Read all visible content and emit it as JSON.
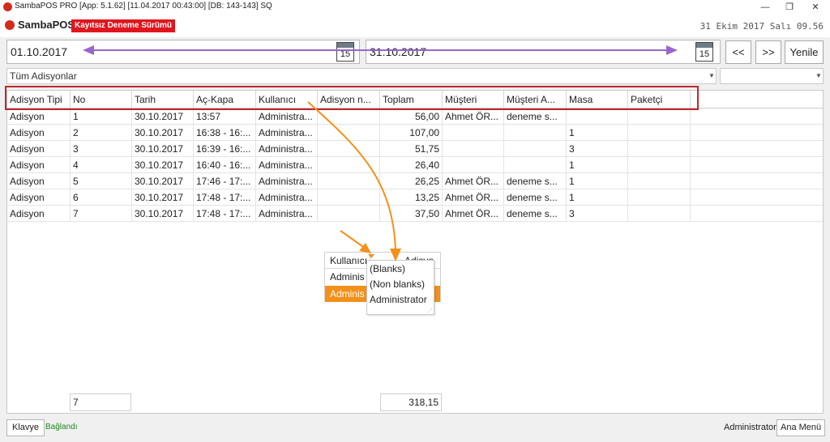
{
  "titlebar": {
    "title": "SambaPOS PRO [App: 5.1.62] [11.04.2017 00:43:00] [DB: 143-143] SQ",
    "minimize": "—",
    "restore": "❐",
    "close": "✕"
  },
  "brand": {
    "logo_text": "SambaPOS",
    "trial_badge": "Kayıtsız Deneme Sürümü",
    "clock": "31 Ekim 2017 Salı 09.56"
  },
  "filters": {
    "start_date": "01.10.2017",
    "end_date": "31.10.2017",
    "calendar_day": "15",
    "prev_label": "<<",
    "next_label": ">>",
    "refresh_label": "Yenile",
    "ticket_type": "Tüm Adisyonlar",
    "second_combo": ""
  },
  "columns": [
    "Adisyon Tipi",
    "No",
    "Tarih",
    "Aç-Kapa",
    "Kullanıcı",
    "Adisyon n...",
    "Toplam",
    "Müşteri",
    "Müşteri A...",
    "Masa",
    "Paketçi"
  ],
  "rows": [
    [
      "Adisyon",
      "1",
      "30.10.2017",
      "13:57",
      "Administra...",
      "",
      "56,00",
      "Ahmet ÖR...",
      "deneme s...",
      "",
      ""
    ],
    [
      "Adisyon",
      "2",
      "30.10.2017",
      "16:38 - 16:...",
      "Administra...",
      "",
      "107,00",
      "",
      "",
      "1",
      ""
    ],
    [
      "Adisyon",
      "3",
      "30.10.2017",
      "16:39 - 16:...",
      "Administra...",
      "",
      "51,75",
      "",
      "",
      "3",
      ""
    ],
    [
      "Adisyon",
      "4",
      "30.10.2017",
      "16:40 - 16:...",
      "Administra...",
      "",
      "26,40",
      "",
      "",
      "1",
      ""
    ],
    [
      "Adisyon",
      "5",
      "30.10.2017",
      "17:46 - 17:...",
      "Administra...",
      "",
      "26,25",
      "Ahmet ÖR...",
      "deneme s...",
      "1",
      ""
    ],
    [
      "Adisyon",
      "6",
      "30.10.2017",
      "17:48 - 17:...",
      "Administra...",
      "",
      "13,25",
      "Ahmet ÖR...",
      "deneme s...",
      "1",
      ""
    ],
    [
      "Adisyon",
      "7",
      "30.10.2017",
      "17:48 - 17:...",
      "Administra...",
      "",
      "37,50",
      "Ahmet ÖR...",
      "deneme s...",
      "3",
      ""
    ]
  ],
  "footer": {
    "count": "7",
    "total": "318,15"
  },
  "filter_popup": {
    "header_label": "Kullanıcı",
    "header_next": "Adisyo",
    "row1": "Adminis",
    "row2": "Adminis",
    "options": [
      "(Blanks)",
      "(Non blanks)",
      "Administrator"
    ]
  },
  "status": {
    "keyboard_label": "Klavye",
    "connection": "Bağlandı",
    "user": "Administrator",
    "main_menu": "Ana Menü"
  },
  "colors": {
    "accent_orange": "#f39019",
    "purple_arrow": "#9966cc",
    "highlight_red": "#c0272d",
    "selected_row": "#f39019"
  }
}
